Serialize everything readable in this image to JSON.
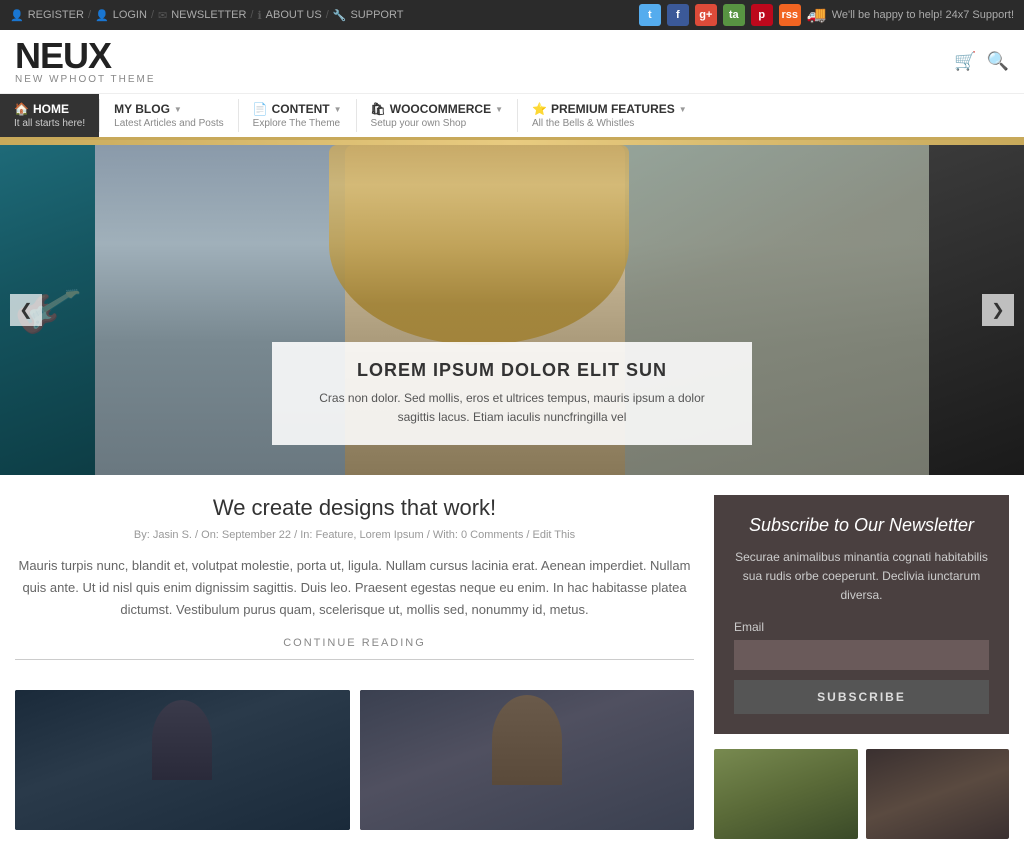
{
  "topbar": {
    "links": [
      {
        "label": "REGISTER",
        "icon": "👤"
      },
      {
        "label": "LOGIN",
        "icon": "👤"
      },
      {
        "label": "NEWSLETTER",
        "icon": "✉"
      },
      {
        "label": "ABOUT US",
        "icon": "ℹ"
      },
      {
        "label": "SUPPORT",
        "icon": "🔧"
      }
    ],
    "social": [
      {
        "name": "twitter",
        "color": "#55acee",
        "letter": "t"
      },
      {
        "name": "facebook",
        "color": "#3b5998",
        "letter": "f"
      },
      {
        "name": "google-plus",
        "color": "#dd4b39",
        "letter": "g+"
      },
      {
        "name": "tripadvisor",
        "color": "#589442",
        "letter": "ta"
      },
      {
        "name": "pinterest",
        "color": "#bd081c",
        "letter": "p"
      },
      {
        "name": "rss",
        "color": "#f26522",
        "letter": "rss"
      }
    ],
    "support": "We'll be happy to help! 24x7 Support!"
  },
  "header": {
    "logo_title": "NEUX",
    "logo_sub": "NEW WPHOOT THEME",
    "cart_icon": "🛒",
    "search_icon": "🔍"
  },
  "nav": {
    "items": [
      {
        "label": "HOME",
        "sub": "It all starts here!",
        "icon": "🏠",
        "active": true,
        "has_arrow": false
      },
      {
        "label": "MY BLOG",
        "sub": "Latest Articles and Posts",
        "icon": "",
        "active": false,
        "has_arrow": true
      },
      {
        "label": "CONTENT",
        "sub": "Explore The Theme",
        "icon": "📄",
        "active": false,
        "has_arrow": true
      },
      {
        "label": "WOOCOMMERCE",
        "sub": "Setup your own Shop",
        "icon": "🛍",
        "active": false,
        "has_arrow": true
      },
      {
        "label": "PREMIUM FEATURES",
        "sub": "All the Bells & Whistles",
        "icon": "⭐",
        "active": false,
        "has_arrow": true
      }
    ]
  },
  "slider": {
    "title": "LOREM IPSUM DOLOR ELIT SUN",
    "caption": "Cras non dolor. Sed mollis, eros et ultrices tempus, mauris ipsum a dolor sagittis lacus. Etiam iaculis nuncfringilla vel",
    "prev_label": "❮",
    "next_label": "❯"
  },
  "blog": {
    "post_title": "We create designs that work!",
    "post_meta": "By: Jasin S.  /  On: September 22  /  In: Feature, Lorem Ipsum  /  With: 0 Comments  /  Edit This",
    "post_body": "Mauris turpis nunc, blandit et, volutpat molestie, porta ut, ligula. Nullam cursus lacinia erat. Aenean imperdiet. Nullam quis ante. Ut id nisl quis enim dignissim sagittis. Duis leo. Praesent egestas neque eu enim. In hac habitasse platea dictumst. Vestibulum purus quam, scelerisque ut, mollis sed, nonummy id, metus.",
    "continue_label": "CONTINUE READING"
  },
  "newsletter": {
    "title": "Subscribe to Our Newsletter",
    "desc": "Securae animalibus minantia cognati habitabilis sua rudis orbe coeperunt. Declivia iunctarum diversa.",
    "email_label": "Email",
    "email_placeholder": "",
    "btn_label": "SUBSCRIBE"
  }
}
